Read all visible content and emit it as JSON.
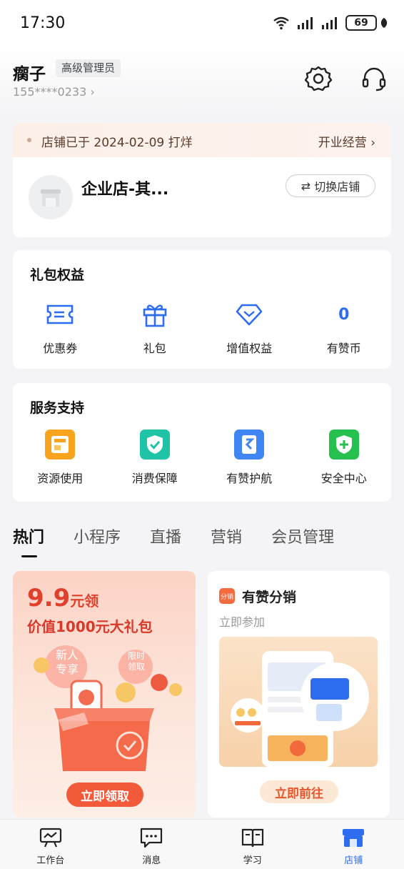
{
  "status_bar": {
    "time": "17:30",
    "battery": "69"
  },
  "user": {
    "name": "瘸子",
    "role": "高级管理员",
    "phone": "155****0233"
  },
  "notice": {
    "text": "店铺已于 2024-02-09 打烊",
    "action": "开业经营"
  },
  "shop": {
    "name": "企业店-其...",
    "switch_label": "切换店铺"
  },
  "gift_section": {
    "title": "礼包权益",
    "items": [
      {
        "label": "优惠券",
        "icon": "coupon-icon"
      },
      {
        "label": "礼包",
        "icon": "gift-icon"
      },
      {
        "label": "增值权益",
        "icon": "diamond-icon"
      },
      {
        "label": "有赞币",
        "value": "0"
      }
    ]
  },
  "service_section": {
    "title": "服务支持",
    "items": [
      {
        "label": "资源使用",
        "icon": "resource-icon"
      },
      {
        "label": "消费保障",
        "icon": "shield-check-icon"
      },
      {
        "label": "有赞护航",
        "icon": "escort-icon"
      },
      {
        "label": "安全中心",
        "icon": "security-shield-icon"
      }
    ]
  },
  "tabs": [
    "热门",
    "小程序",
    "直播",
    "营销",
    "会员管理"
  ],
  "promo_left": {
    "price": "9.9",
    "price_unit": "元领",
    "subtitle": "价值1000元大礼包",
    "bubble1": "新人专享",
    "bubble2": "限时领取",
    "cta": "立即领取"
  },
  "promo_right": {
    "badge": "分销",
    "title": "有赞分销",
    "subtitle": "立即参加",
    "cta": "立即前往"
  },
  "bottom_nav": [
    {
      "label": "工作台",
      "icon": "workbench-icon"
    },
    {
      "label": "消息",
      "icon": "message-icon"
    },
    {
      "label": "学习",
      "icon": "book-icon"
    },
    {
      "label": "店铺",
      "icon": "store-icon"
    }
  ],
  "colors": {
    "accent": "#2f6df0",
    "promo_red": "#e0412c",
    "notice_bg": "#fbefe8"
  }
}
